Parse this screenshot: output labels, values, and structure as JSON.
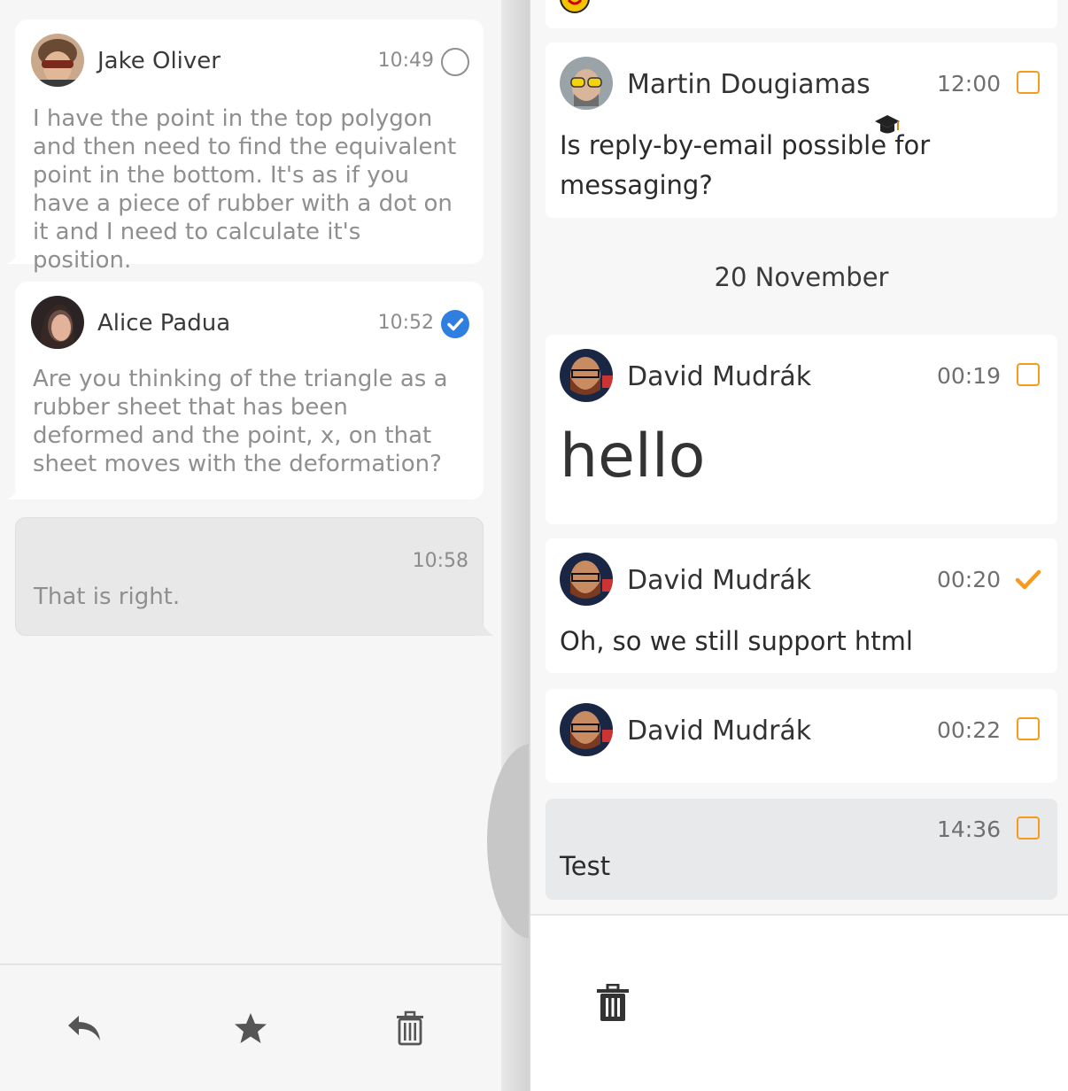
{
  "left_pane": {
    "messages": [
      {
        "sender": "Jake Oliver",
        "time": "10:49",
        "status": "unread",
        "body": "I have the point in the top polygon and then need to find the equivalent point in the bottom. It's as if you have a piece of rubber with a dot on it and I need to calculate it's position."
      },
      {
        "sender": "Alice Padua",
        "time": "10:52",
        "status": "read",
        "body": "Are you thinking of the triangle as a rubber sheet that has been deformed and the point, x, on that sheet moves with the deformation?"
      }
    ],
    "own_message": {
      "time": "10:58",
      "body": "That is right."
    },
    "toolbar": {
      "reply_icon": "reply-icon",
      "star_icon": "star-icon",
      "delete_icon": "trash-icon"
    }
  },
  "drawer": {
    "messages": [
      {
        "sender": "Martin Dougiamas",
        "badge_icon": "graduation-cap-icon",
        "time": "12:00",
        "selected": false,
        "text": "Is reply-by-email possible for messaging?"
      }
    ],
    "date_separator": "20 November",
    "messages_after": [
      {
        "sender": "David Mudrák",
        "time": "00:19",
        "selected": false,
        "text": "hello"
      },
      {
        "sender": "David Mudrák",
        "time": "00:20",
        "selected": true,
        "text": "Oh, so we still support html"
      },
      {
        "sender": "David Mudrák",
        "time": "00:22",
        "selected": false,
        "text": ""
      }
    ],
    "own_message": {
      "time": "14:36",
      "selected": false,
      "text": "Test"
    },
    "footer": {
      "delete_icon": "trash-icon"
    }
  },
  "colors": {
    "accent_orange": "#f79a1f",
    "read_blue": "#2f7fe0",
    "muted_text": "#8f8f8f"
  }
}
